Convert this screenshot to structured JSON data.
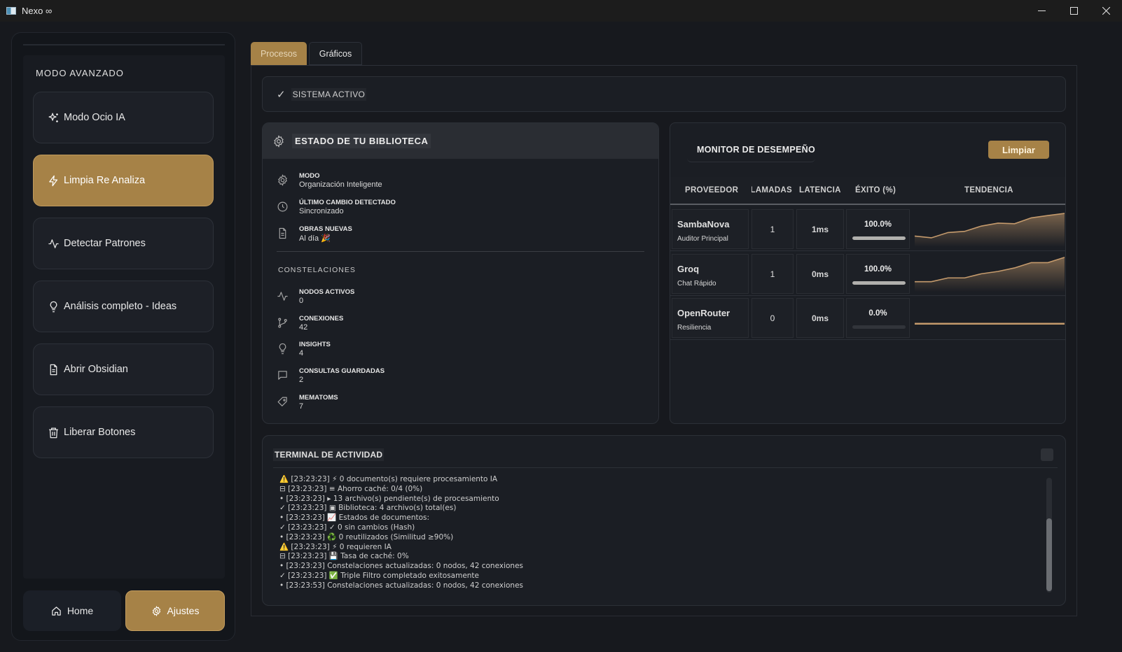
{
  "window": {
    "title": "Nexo ∞"
  },
  "sidebar": {
    "heading": "MODO AVANZADO",
    "items": [
      {
        "label": "Modo Ocio IA",
        "icon": "sparkles-icon",
        "active": false
      },
      {
        "label": "Limpia Re Analiza",
        "icon": "lightning-icon",
        "active": true
      },
      {
        "label": "Detectar Patrones",
        "icon": "activity-icon",
        "active": false
      },
      {
        "label": "Análisis completo - Ideas",
        "icon": "lightbulb-icon",
        "active": false
      },
      {
        "label": "Abrir Obsidian",
        "icon": "document-icon",
        "active": false
      },
      {
        "label": "Liberar Botones",
        "icon": "trash-icon",
        "active": false
      }
    ],
    "home_label": "Home",
    "settings_label": "Ajustes"
  },
  "tabs": [
    {
      "label": "Procesos",
      "active": true
    },
    {
      "label": "Gráficos",
      "active": false
    }
  ],
  "status": {
    "label": "SISTEMA ACTIVO"
  },
  "library": {
    "title": "ESTADO DE TU BIBLIOTECA",
    "items": [
      {
        "key": "MODO",
        "value": "Organización Inteligente",
        "icon": "gear-icon"
      },
      {
        "key": "ÚLTIMO CAMBIO DETECTADO",
        "value": "Sincronizado",
        "icon": "clock-icon"
      },
      {
        "key": "OBRAS NUEVAS",
        "value": "Al día 🎉",
        "icon": "document-icon"
      }
    ],
    "constellations_heading": "CONSTELACIONES",
    "constellations": [
      {
        "key": "NODOS ACTIVOS",
        "value": "0",
        "icon": "activity-icon"
      },
      {
        "key": "CONEXIONES",
        "value": "42",
        "icon": "branch-icon"
      },
      {
        "key": "INSIGHTS",
        "value": "4",
        "icon": "lightbulb-icon"
      },
      {
        "key": "CONSULTAS GUARDADAS",
        "value": "2",
        "icon": "chat-icon"
      },
      {
        "key": "MEMATOMS",
        "value": "7",
        "icon": "tag-icon"
      }
    ]
  },
  "monitor": {
    "title": "MONITOR DE DESEMPEÑO",
    "clear_label": "Limpiar",
    "headers": [
      "PROVEEDOR",
      "LLAMADAS",
      "LATENCIA",
      "ÉXITO (%)",
      "TENDENCIA"
    ],
    "rows": [
      {
        "name": "SambaNova",
        "role": "Auditor Principal",
        "calls": "1",
        "latency": "1ms",
        "success": "100.0%",
        "success_value": 100,
        "trend": [
          0.82,
          0.88,
          0.7,
          0.66,
          0.48,
          0.38,
          0.4,
          0.2,
          0.12,
          0.05
        ]
      },
      {
        "name": "Groq",
        "role": "Chat Rápido",
        "calls": "1",
        "latency": "0ms",
        "success": "100.0%",
        "success_value": 100,
        "trend": [
          0.85,
          0.85,
          0.72,
          0.72,
          0.58,
          0.5,
          0.38,
          0.2,
          0.2,
          0.02
        ]
      },
      {
        "name": "OpenRouter",
        "role": "Resiliencia",
        "calls": "0",
        "latency": "0ms",
        "success": "0.0%",
        "success_value": 0,
        "trend": [
          0.78,
          0.78,
          0.78,
          0.78,
          0.78,
          0.78,
          0.78,
          0.78,
          0.78,
          0.78
        ]
      }
    ]
  },
  "terminal": {
    "title": "TERMINAL DE ACTIVIDAD",
    "lines": [
      "⚠️ [23:23:23]  ⚡ 0 documento(s) requiere procesamiento IA",
      "⊟ [23:23:23] ≡ Ahorro caché: 0/4 (0%)",
      "• [23:23:23] ▸ 13 archivo(s) pendiente(s) de procesamiento",
      "✓ [23:23:23] ▣ Biblioteca: 4 archivo(s) total(es)",
      "• [23:23:23] 📈 Estados de documentos:",
      "✓ [23:23:23] ✓ 0 sin cambios (Hash)",
      "• [23:23:23] ♻️ 0 reutilizados (Similitud ≥90%)",
      "⚠️ [23:23:23]  ⚡ 0 requieren IA",
      "⊟ [23:23:23] 💾 Tasa de caché: 0%",
      "• [23:23:23] Constelaciones actualizadas: 0 nodos, 42 conexiones",
      "✓ [23:23:23] ✅ Triple Filtro completado exitosamente",
      "• [23:23:53] Constelaciones actualizadas: 0 nodos, 42 conexiones"
    ]
  },
  "colors": {
    "accent": "#a68247",
    "background": "#17191e",
    "panel": "#1b1e24"
  }
}
